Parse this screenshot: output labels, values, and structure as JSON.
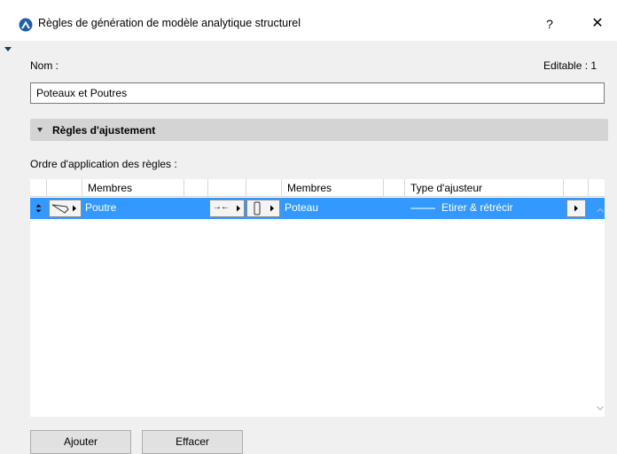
{
  "window": {
    "title": "Règles de génération de modèle analytique structurel",
    "help_label": "?",
    "close_label": "✕"
  },
  "form": {
    "name_label": "Nom :",
    "editable_label": "Editable : 1",
    "name_value": "Poteaux et Poutres"
  },
  "section": {
    "title": "Règles d'ajustement",
    "order_label": "Ordre d'application des règles :"
  },
  "table": {
    "headers": {
      "members_1": "Membres",
      "members_2": "Membres",
      "adjuster_type": "Type d'ajusteur"
    },
    "rows": [
      {
        "member_1": "Poutre",
        "connector_glyph": "→←",
        "member_2": "Poteau",
        "adjuster": "Etirer & rétrécir"
      }
    ]
  },
  "buttons": {
    "add": "Ajouter",
    "delete": "Effacer"
  },
  "colors": {
    "selection": "#3399ff",
    "background": "#f0f0f0",
    "section_header": "#d4d4d4",
    "app_icon": "#1f5fa8"
  },
  "icons": [
    "app-icon",
    "help-icon",
    "close-icon",
    "collapse-triangle-icon",
    "drag-handle-icon",
    "beam-icon",
    "column-icon",
    "menu-arrow-icon",
    "line-style-icon",
    "scroll-up-icon",
    "scroll-down-icon"
  ]
}
